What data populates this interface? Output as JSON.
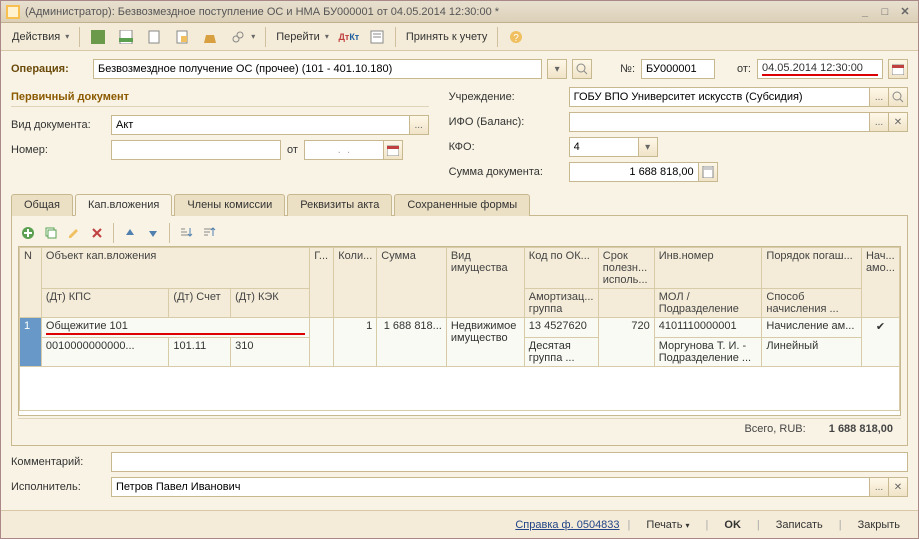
{
  "title": "(Администратор): Безвозмездное поступление ОС и НМА БУ000001 от 04.05.2014 12:30:00 *",
  "toolbar": {
    "actions": "Действия",
    "goto": "Перейти",
    "accept": "Принять к учету"
  },
  "header": {
    "op_label": "Операция:",
    "op_value": "Безвозмездное получение ОС (прочее) (101 - 401.10.180)",
    "num_label": "№:",
    "num_value": "БУ000001",
    "from_label": "от:",
    "date_value": "04.05.2014 12:30:00"
  },
  "left": {
    "section": "Первичный документ",
    "doctype_label": "Вид документа:",
    "doctype_value": "Акт",
    "number_label": "Номер:",
    "number_from": "от",
    "number_dots": ".  ."
  },
  "right": {
    "org_label": "Учреждение:",
    "org_value": "ГОБУ ВПО Университет искусств (Субсидия)",
    "ifo_label": "ИФО (Баланс):",
    "ifo_value": "",
    "kfo_label": "КФО:",
    "kfo_value": "4",
    "sum_label": "Сумма документа:",
    "sum_value": "1 688 818,00"
  },
  "tabs": {
    "t1": "Общая",
    "t2": "Кап.вложения",
    "t3": "Члены комиссии",
    "t4": "Реквизиты акта",
    "t5": "Сохраненные формы"
  },
  "grid": {
    "h_n": "N",
    "h_obj": "Объект кап.вложения",
    "h_kps": "(Дт) КПС",
    "h_schet": "(Дт) Счет",
    "h_kek": "(Дт) КЭК",
    "h_g": "Г...",
    "h_kol": "Коли...",
    "h_sum": "Сумма",
    "h_vid": "Вид имущества",
    "h_kod": "Код по ОК...",
    "h_amort": "Амортизац... группа",
    "h_srok": "Срок полезн... исполь...",
    "h_inv": "Инв.номер",
    "h_mol": "МОЛ / Подразделение",
    "h_por": "Порядок погаш...",
    "h_sposob": "Способ начисления ...",
    "h_nach": "Нач... амо...",
    "r1_n": "1",
    "r1_obj": "Общежитие 101",
    "r1_kps": "0010000000000...",
    "r1_schet": "101.11",
    "r1_kek": "310",
    "r1_kol": "1",
    "r1_sum": "1 688 818...",
    "r1_vid": "Недвижимое имущество",
    "r1_kod": "13 4527620",
    "r1_amort": "Десятая группа ...",
    "r1_srok": "720",
    "r1_inv": "4101110000001",
    "r1_mol": "Моргунова Т. И. - Подразделение ...",
    "r1_por": "Начисление ам...",
    "r1_sposob": "Линейный",
    "r1_nach": "✔"
  },
  "totals": {
    "label": "Всего, RUB:",
    "value": "1 688 818,00"
  },
  "bottom": {
    "comment_label": "Комментарий:",
    "comment_value": "",
    "performer_label": "Исполнитель:",
    "performer_value": "Петров Павел Иванович"
  },
  "footer": {
    "ref": "Справка ф. 0504833",
    "print": "Печать",
    "ok": "OK",
    "save": "Записать",
    "close": "Закрыть"
  }
}
